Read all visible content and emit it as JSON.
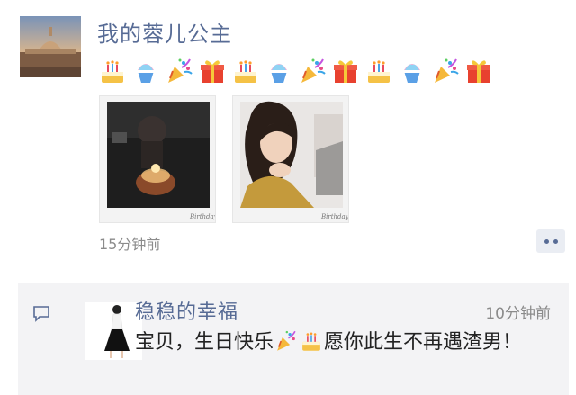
{
  "post": {
    "author": "我的蓉儿公主",
    "emojis": [
      "cake-emoji",
      "shaved-ice-emoji",
      "party-popper-emoji",
      "gift-emoji",
      "cake-emoji",
      "shaved-ice-emoji",
      "party-popper-emoji",
      "gift-emoji",
      "cake-emoji",
      "shaved-ice-emoji",
      "party-popper-emoji",
      "gift-emoji"
    ],
    "photos": [
      "birthday-cake-photo",
      "portrait-photo"
    ],
    "time": "15分钟前",
    "more_icon": "more-dots-icon"
  },
  "comment": {
    "icon": "comment-icon",
    "author": "稳稳的幸福",
    "time": "10分钟前",
    "text_part1": "宝贝，生日快乐",
    "text_part2": "愿你此生不再遇渣男！"
  },
  "colors": {
    "name_link": "#576b95",
    "meta_gray": "#8b8b8b",
    "comment_bg": "#f3f3f5"
  }
}
